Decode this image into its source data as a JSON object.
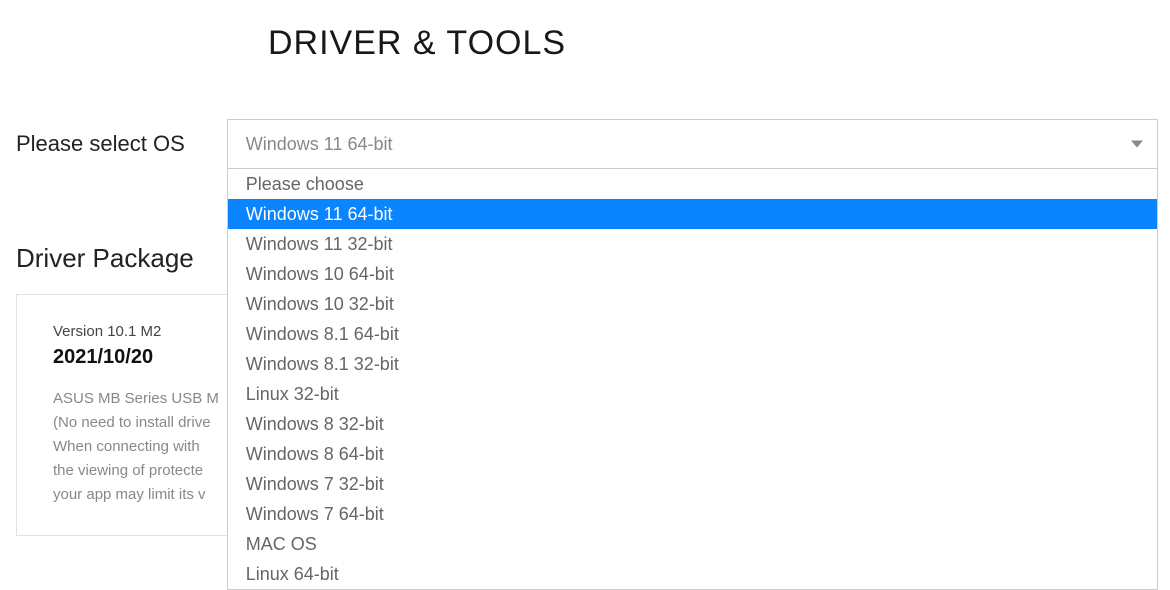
{
  "pageTitle": "DRIVER & TOOLS",
  "osSelect": {
    "label": "Please select OS",
    "selectedValue": "Windows 11 64-bit",
    "options": [
      "Please choose",
      "Windows 11 64-bit",
      "Windows 11 32-bit",
      "Windows 10 64-bit",
      "Windows 10 32-bit",
      "Windows 8.1 64-bit",
      "Windows 8.1 32-bit",
      "Linux 32-bit",
      "Windows 8 32-bit",
      "Windows 8 64-bit",
      "Windows 7 32-bit",
      "Windows 7 64-bit",
      "MAC OS",
      "Linux 64-bit"
    ],
    "selectedIndex": 1
  },
  "driverPackage": {
    "sectionTitle": "Driver Package",
    "versionLabel": "Version 10.1 M2",
    "date": "2021/10/20",
    "descLine1": "ASUS MB Series USB M",
    "descLine2": "(No need to install drive",
    "descLine3": "When connecting with",
    "descLine4": "the viewing of protecte",
    "descLine5": "your app may limit its v"
  }
}
